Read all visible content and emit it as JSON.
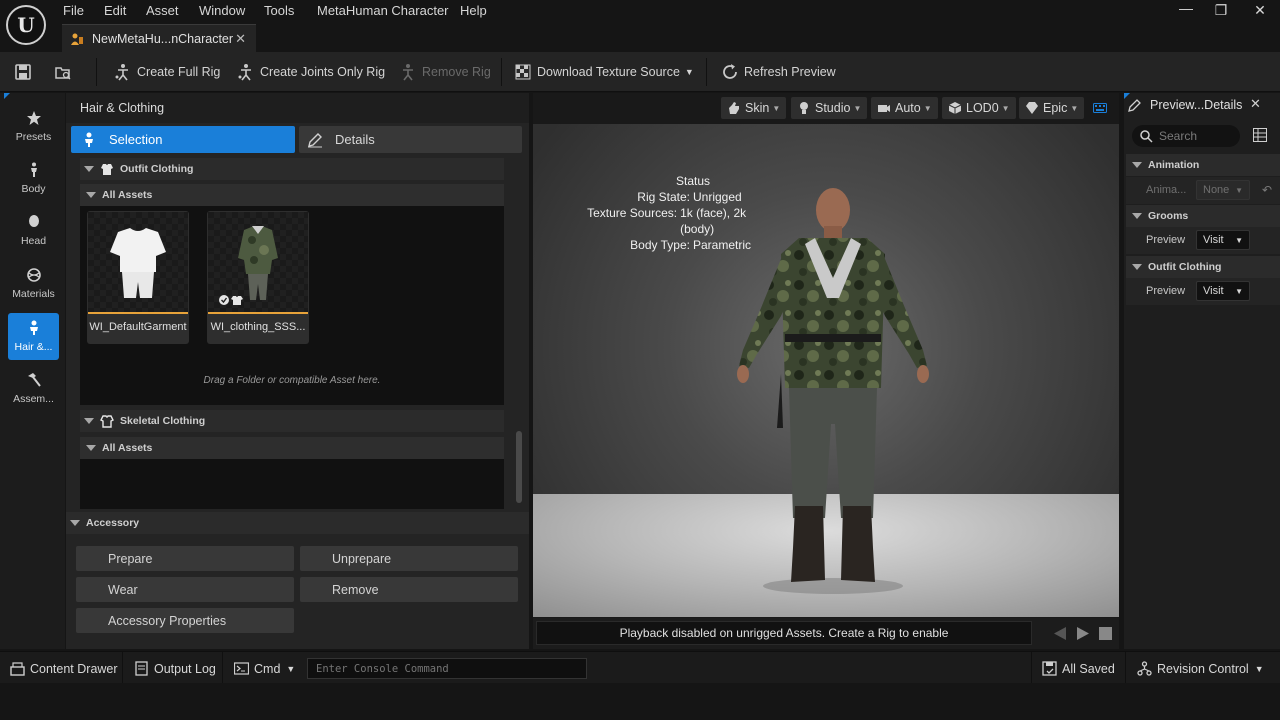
{
  "app": {
    "menus": [
      "File",
      "Edit",
      "Asset",
      "Window",
      "Tools",
      "MetaHuman Character",
      "Help"
    ],
    "document_tab": "NewMetaHu...nCharacter"
  },
  "toolbar": {
    "create_full_rig": "Create Full Rig",
    "create_joints_only_rig": "Create Joints Only Rig",
    "remove_rig": "Remove Rig",
    "download_texture_source": "Download Texture Source",
    "refresh_preview": "Refresh Preview"
  },
  "left_rail": {
    "items": [
      {
        "label": "Presets",
        "icon": "star-icon"
      },
      {
        "label": "Body",
        "icon": "body-icon"
      },
      {
        "label": "Head",
        "icon": "head-icon"
      },
      {
        "label": "Materials",
        "icon": "materials-icon"
      },
      {
        "label": "Hair &...",
        "icon": "hair-clothing-icon",
        "active": true
      },
      {
        "label": "Assem...",
        "icon": "hammer-icon"
      }
    ]
  },
  "panel": {
    "title": "Hair & Clothing",
    "tabs": {
      "selection": "Selection",
      "details": "Details"
    },
    "outfit_clothing": {
      "heading": "Outfit Clothing",
      "all_assets": "All Assets",
      "assets": [
        {
          "name": "WI_DefaultGarment"
        },
        {
          "name": "WI_clothing_SSS..."
        }
      ],
      "drag_hint": "Drag a Folder or compatible Asset here."
    },
    "skeletal_clothing": {
      "heading": "Skeletal Clothing",
      "all_assets": "All Assets"
    },
    "accessory": {
      "heading": "Accessory",
      "buttons": {
        "prepare": "Prepare",
        "unprepare": "Unprepare",
        "wear": "Wear",
        "remove": "Remove",
        "properties": "Accessory Properties"
      }
    }
  },
  "viewport": {
    "toolbar": {
      "skin": "Skin",
      "studio": "Studio",
      "auto": "Auto",
      "lod": "LOD0",
      "quality": "Epic"
    },
    "status": {
      "title": "Status",
      "rows": [
        {
          "key": "Rig State:",
          "value": "Unrigged"
        },
        {
          "key": "Texture Sources:",
          "value": "1k (face), 2k (body)"
        },
        {
          "key": "Body Type:",
          "value": "Parametric"
        }
      ]
    },
    "playback_message": "Playback disabled on unrigged Assets. Create a Rig to enable"
  },
  "details_panel": {
    "tab": "Preview...Details",
    "search_placeholder": "Search",
    "sections": {
      "animation": {
        "heading": "Animation",
        "row_label": "Anima...",
        "value": "None"
      },
      "grooms": {
        "heading": "Grooms",
        "row_label": "Preview",
        "value": "Visit"
      },
      "outfit": {
        "heading": "Outfit Clothing",
        "row_label": "Preview",
        "value": "Visit"
      }
    }
  },
  "statusbar": {
    "content_drawer": "Content Drawer",
    "output_log": "Output Log",
    "cmd": "Cmd",
    "console_placeholder": "Enter Console Command",
    "all_saved": "All Saved",
    "revision_control": "Revision Control"
  },
  "colors": {
    "accent": "#1a7fd9",
    "asset_underline": "#e8a33a",
    "background": "#151515"
  }
}
